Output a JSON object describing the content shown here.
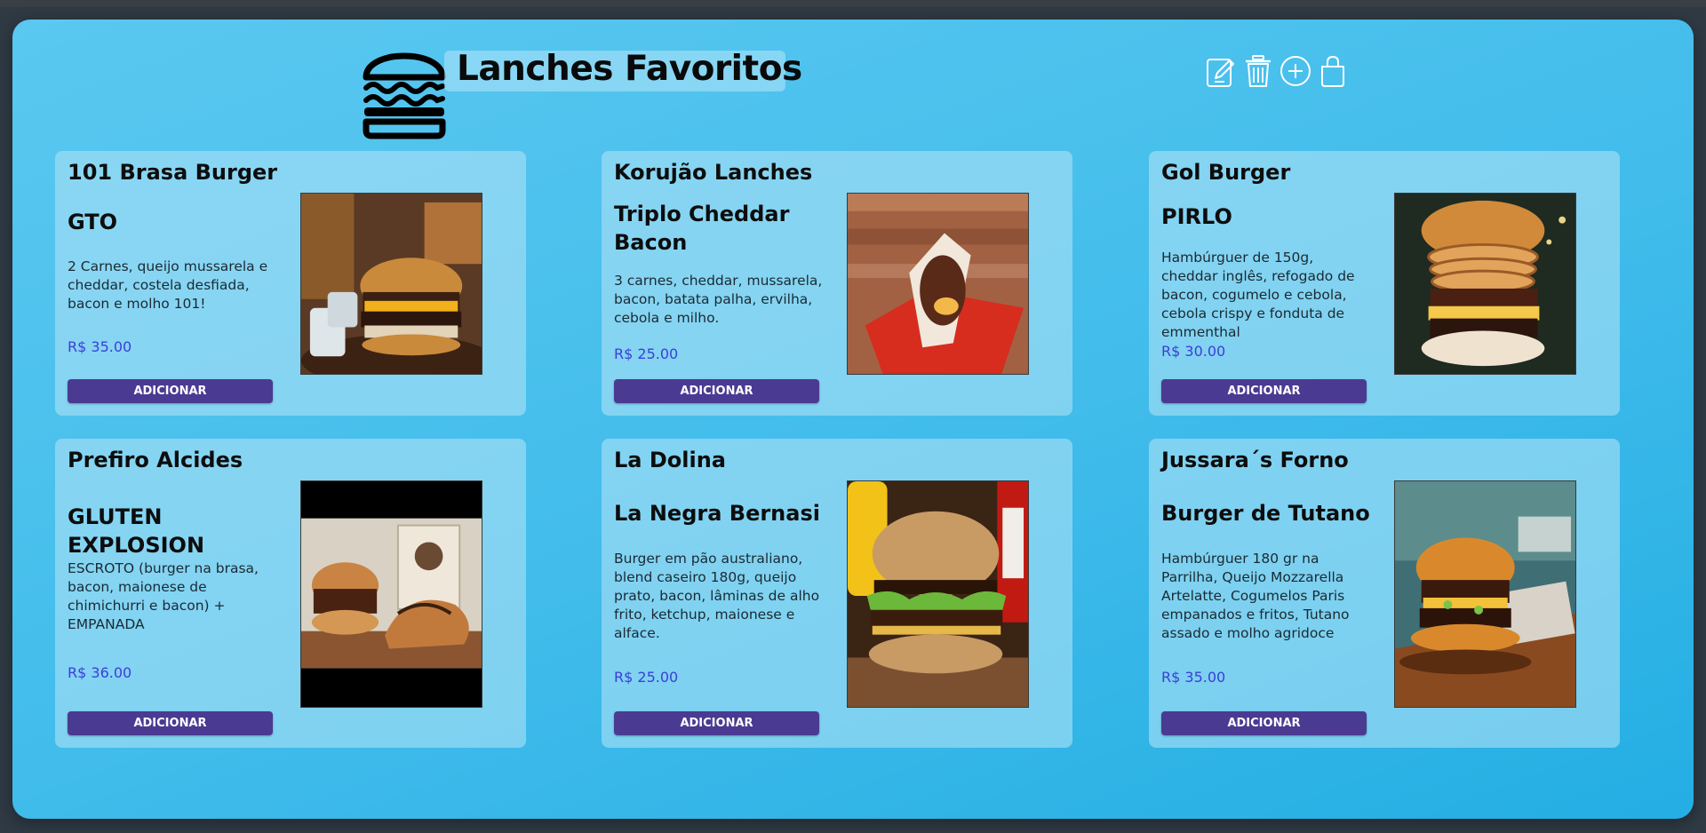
{
  "header": {
    "title": "Lanches Favoritos",
    "logo_icon": "burger-icon",
    "toolbar": [
      {
        "icon": "edit-icon"
      },
      {
        "icon": "trash-icon"
      },
      {
        "icon": "add-circle-icon"
      },
      {
        "icon": "shopping-bag-icon"
      }
    ]
  },
  "products": [
    {
      "restaurant": "101 Brasa Burger",
      "dish": "GTO",
      "description": "2 Carnes, queijo mussarela e cheddar, costela desfiada, bacon e molho 101!",
      "price": "R$ 35.00",
      "button": "ADICIONAR",
      "image_icon": "burger-photo"
    },
    {
      "restaurant": "Korujão Lanches",
      "dish": "Triplo Cheddar Bacon",
      "description": "3 carnes, cheddar, mussarela, bacon, batata palha, ervilha, cebola e milho.",
      "price": "R$ 25.00",
      "button": "ADICIONAR",
      "image_icon": "burger-photo"
    },
    {
      "restaurant": "Gol Burger",
      "dish": "PIRLO",
      "description": "Hambúrguer de 150g, cheddar inglês, refogado de bacon, cogumelo e cebola, cebola crispy e fonduta de emmenthal",
      "price": "R$ 30.00",
      "button": "ADICIONAR",
      "image_icon": "burger-photo"
    },
    {
      "restaurant": "Prefiro Alcides",
      "dish": "GLUTEN EXPLOSION",
      "description": "ESCROTO (burger na brasa, bacon, maionese de chimichurri e bacon) + EMPANADA",
      "price": "R$ 36.00",
      "button": "ADICIONAR",
      "image_icon": "burger-photo"
    },
    {
      "restaurant": "La Dolina",
      "dish": "La Negra Bernasi",
      "description": "Burger em pão australiano, blend caseiro 180g, queijo prato, bacon, lâminas de alho frito, ketchup, maionese e alface.",
      "price": "R$ 25.00",
      "button": "ADICIONAR",
      "image_icon": "burger-photo"
    },
    {
      "restaurant": "Jussara´s Forno",
      "dish": "Burger de Tutano",
      "description": "Hambúrguer 180 gr na Parrilha, Queijo Mozzarella Artelatte, Cogumelos Paris empanados e fritos, Tutano assado e molho agridoce",
      "price": "R$ 35.00",
      "button": "ADICIONAR",
      "image_icon": "burger-photo"
    }
  ],
  "colors": {
    "panel": "#41bceb",
    "card": "#aae1f6",
    "button": "#4a3a92",
    "price": "#3b3fd6"
  }
}
